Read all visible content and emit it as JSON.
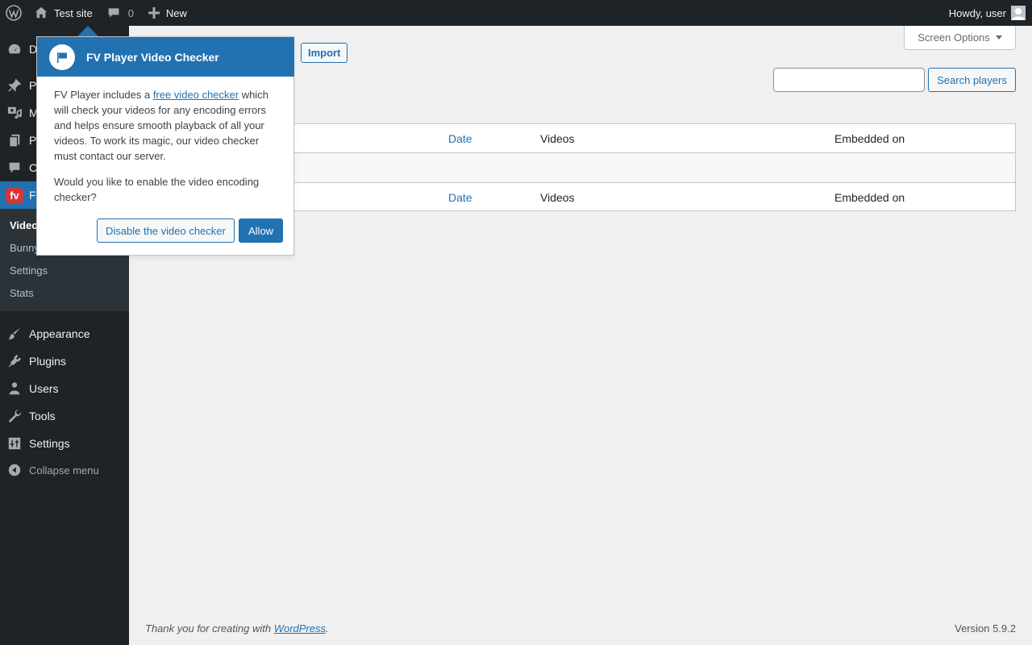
{
  "adminbar": {
    "site_name": "Test site",
    "comments_count": "0",
    "new_label": "New",
    "howdy": "Howdy, user"
  },
  "sidebar": {
    "items": [
      {
        "key": "dashboard",
        "label": "D",
        "icon": "dashboard-icon"
      },
      {
        "key": "posts",
        "label": "P",
        "icon": "pin-icon"
      },
      {
        "key": "media",
        "label": "M",
        "icon": "media-icon"
      },
      {
        "key": "pages",
        "label": "P",
        "icon": "pages-icon"
      },
      {
        "key": "comments",
        "label": "C",
        "icon": "comment-icon"
      },
      {
        "key": "fvplayer",
        "label": "F",
        "icon": "fv-logo-icon",
        "badge": "fv"
      }
    ],
    "submenu": [
      "Video",
      "Bunny",
      "Settings",
      "Stats"
    ],
    "lower_items": [
      {
        "key": "appearance",
        "label": "Appearance",
        "icon": "brush-icon"
      },
      {
        "key": "plugins",
        "label": "Plugins",
        "icon": "plugin-icon"
      },
      {
        "key": "users",
        "label": "Users",
        "icon": "user-icon"
      },
      {
        "key": "tools",
        "label": "Tools",
        "icon": "wrench-icon"
      },
      {
        "key": "settings",
        "label": "Settings",
        "icon": "settings-icon"
      }
    ],
    "collapse_label": "Collapse menu"
  },
  "main": {
    "screen_options": "Screen Options",
    "import_label": "Import",
    "search_button": "Search players",
    "search_value": "",
    "table": {
      "headers": [
        "Date",
        "Videos",
        "Embedded on"
      ],
      "footers": [
        "Date",
        "Videos",
        "Embedded on"
      ]
    }
  },
  "pointer": {
    "title": "FV Player Video Checker",
    "body_before_link": "FV Player includes a ",
    "link_text": "free video checker",
    "body_after_link": " which will check your videos for any encoding errors and helps ensure smooth playback of all your videos. To work its magic, our video checker must contact our server.",
    "question": "Would you like to enable the video encoding checker?",
    "disable_button": "Disable the video checker",
    "allow_button": "Allow"
  },
  "footer": {
    "thanks_prefix": "Thank you for creating with ",
    "thanks_link": "WordPress",
    "thanks_suffix": ".",
    "version": "Version 5.9.2"
  },
  "colors": {
    "accent": "#2271b1",
    "adminbar_bg": "#1d2327",
    "fv_badge": "#d63638"
  }
}
